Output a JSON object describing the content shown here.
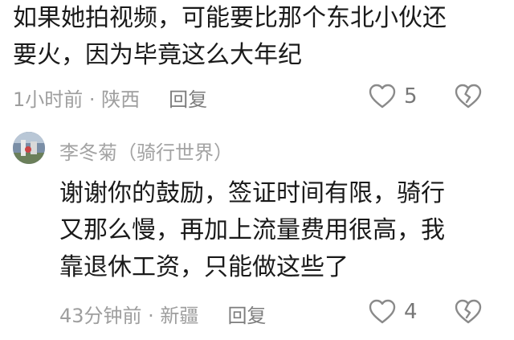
{
  "top_comment": {
    "text_line1": "如果她拍视频，可能要比那个东北小伙还",
    "text_line2": "要火，因为毕竟这么大年纪",
    "time_location": "1小时前 · 陕西",
    "reply_label": "回复",
    "like_count": "5"
  },
  "reply": {
    "author": "李冬菊（骑行世界）",
    "text_line1": "谢谢你的鼓励，签证时间有限，骑行",
    "text_line2": "又那么慢，再加上流量费用很高，我",
    "text_line3": "靠退休工资，只能做这些了",
    "time_location": "43分钟前 · 新疆",
    "reply_label": "回复",
    "like_count": "4"
  },
  "colors": {
    "text": "#1a1a1a",
    "meta": "#9e9e9e",
    "icon": "#8a8a8a"
  },
  "icons": {
    "like": "heart-outline-icon",
    "dislike": "broken-heart-icon"
  }
}
